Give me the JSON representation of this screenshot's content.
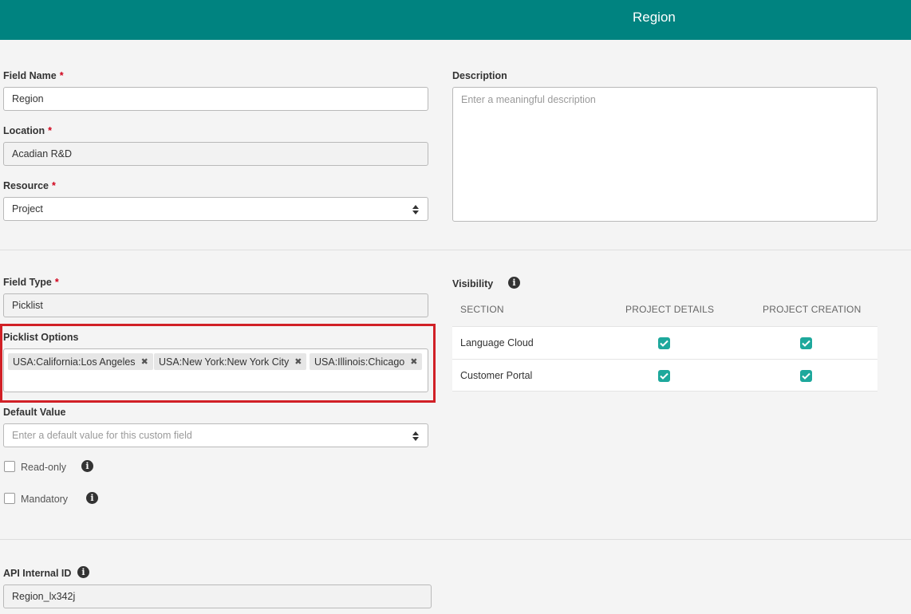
{
  "header": {
    "title": "Region"
  },
  "form": {
    "field_name": {
      "label": "Field Name",
      "required": "*",
      "value": "Region"
    },
    "location": {
      "label": "Location",
      "required": "*",
      "value": "Acadian R&D"
    },
    "resource": {
      "label": "Resource",
      "required": "*",
      "value": "Project"
    },
    "description": {
      "label": "Description",
      "placeholder": "Enter a meaningful description"
    },
    "field_type": {
      "label": "Field Type",
      "required": "*",
      "value": "Picklist"
    },
    "picklist_options": {
      "label": "Picklist Options",
      "items": [
        {
          "label": "USA:California:Los Angeles",
          "remove": "✖"
        },
        {
          "label": "USA:New York:New York City",
          "remove": "✖"
        },
        {
          "label": "USA:Illinois:Chicago",
          "remove": "✖"
        }
      ]
    },
    "default_value": {
      "label": "Default Value",
      "placeholder": "Enter a default value for this custom field"
    },
    "read_only": {
      "label": "Read-only",
      "checked": false
    },
    "mandatory": {
      "label": "Mandatory",
      "checked": false
    },
    "api_internal_id": {
      "label": "API Internal ID",
      "value": "Region_lx342j"
    }
  },
  "visibility": {
    "title": "Visibility",
    "columns": [
      "SECTION",
      "PROJECT DETAILS",
      "PROJECT CREATION"
    ],
    "rows": [
      {
        "section": "Language Cloud",
        "project_details": true,
        "project_creation": true
      },
      {
        "section": "Customer Portal",
        "project_details": true,
        "project_creation": true
      }
    ]
  },
  "colors": {
    "header": "#008380",
    "highlight": "#d12026",
    "checkbox_checked": "#1ea89c",
    "required": "#d0021b"
  },
  "icons": [
    "info-icon",
    "sort-arrows-icon",
    "remove-icon",
    "check-icon"
  ]
}
